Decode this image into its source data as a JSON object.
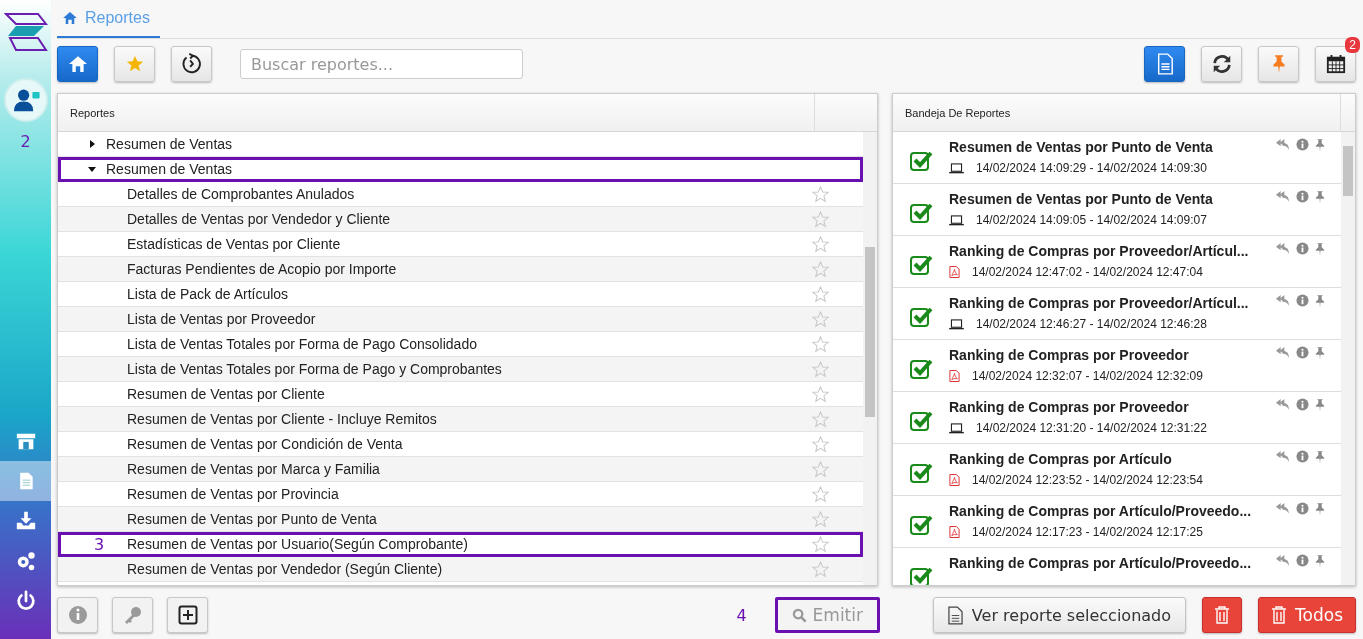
{
  "sidebar": {
    "callout": "2",
    "items": [
      {
        "kind": "store",
        "selected": false
      },
      {
        "kind": "document",
        "selected": true
      },
      {
        "kind": "download",
        "selected": false
      },
      {
        "kind": "settings",
        "selected": false
      },
      {
        "kind": "power",
        "selected": false
      }
    ]
  },
  "tabs": [
    {
      "label": "Reportes",
      "selected": true
    }
  ],
  "toolbar": {
    "search": {
      "placeholder": "Buscar reportes..."
    },
    "calendar_badge": "2"
  },
  "reports": {
    "header": "Reportes",
    "groups": [
      {
        "label": "Resumen de Ventas",
        "expanded": false,
        "outlined": false
      },
      {
        "label": "Resumen de Ventas",
        "expanded": true,
        "outlined": true,
        "items": [
          {
            "label": "Detalles de Comprobantes Anulados",
            "outlined": false
          },
          {
            "label": "Detalles de Ventas por Vendedor y Cliente",
            "outlined": false
          },
          {
            "label": "Estadísticas de Ventas por Cliente",
            "outlined": false
          },
          {
            "label": "Facturas Pendientes de Acopio por Importe",
            "outlined": false
          },
          {
            "label": "Lista de Pack de Artículos",
            "outlined": false
          },
          {
            "label": "Lista de Ventas por Proveedor",
            "outlined": false
          },
          {
            "label": "Lista de Ventas Totales por Forma de Pago Consolidado",
            "outlined": false
          },
          {
            "label": "Lista de Ventas Totales por Forma de Pago y Comprobantes",
            "outlined": false
          },
          {
            "label": "Resumen de Ventas por Cliente",
            "outlined": false
          },
          {
            "label": "Resumen de Ventas por Cliente - Incluye Remitos",
            "outlined": false
          },
          {
            "label": "Resumen de Ventas por Condición de Venta",
            "outlined": false
          },
          {
            "label": "Resumen de Ventas por Marca y Familia",
            "outlined": false
          },
          {
            "label": "Resumen de Ventas por Provincia",
            "outlined": false
          },
          {
            "label": "Resumen de Ventas por Punto de Venta",
            "outlined": false
          },
          {
            "label": "Resumen de Ventas por Usuario(Según Comprobante)",
            "outlined": true,
            "callout": "3"
          },
          {
            "label": "Resumen de Ventas por Vendedor (Según Cliente)",
            "outlined": false
          }
        ]
      }
    ]
  },
  "tray": {
    "header": "Bandeja De Reportes",
    "items": [
      {
        "title": "Resumen de Ventas por Punto de Venta",
        "kind": "screen",
        "time": "14/02/2024 14:09:29 - 14/02/2024 14:09:30"
      },
      {
        "title": "Resumen de Ventas por Punto de Venta",
        "kind": "screen",
        "time": "14/02/2024 14:09:05 - 14/02/2024 14:09:07"
      },
      {
        "title": "Ranking de Compras por Proveedor/Artícul...",
        "kind": "pdf",
        "time": "14/02/2024 12:47:02 - 14/02/2024 12:47:04"
      },
      {
        "title": "Ranking de Compras por Proveedor/Artícul...",
        "kind": "screen",
        "time": "14/02/2024 12:46:27 - 14/02/2024 12:46:28"
      },
      {
        "title": "Ranking de Compras por Proveedor",
        "kind": "pdf",
        "time": "14/02/2024 12:32:07 - 14/02/2024 12:32:09"
      },
      {
        "title": "Ranking de Compras por Proveedor",
        "kind": "screen",
        "time": "14/02/2024 12:31:20 - 14/02/2024 12:31:22"
      },
      {
        "title": "Ranking de Compras por Artículo",
        "kind": "pdf",
        "time": "14/02/2024 12:23:52 - 14/02/2024 12:23:54"
      },
      {
        "title": "Ranking de Compras por Artículo/Proveedo...",
        "kind": "pdf",
        "time": "14/02/2024 12:17:23 - 14/02/2024 12:17:25"
      },
      {
        "title": "Ranking de Compras por Artículo/Proveedo..."
      }
    ]
  },
  "footer": {
    "emit": {
      "label": "Emitir",
      "disabled": true,
      "outlined": true,
      "callout": "4"
    },
    "view": "Ver reporte seleccionado",
    "delete_all": "Todos"
  }
}
